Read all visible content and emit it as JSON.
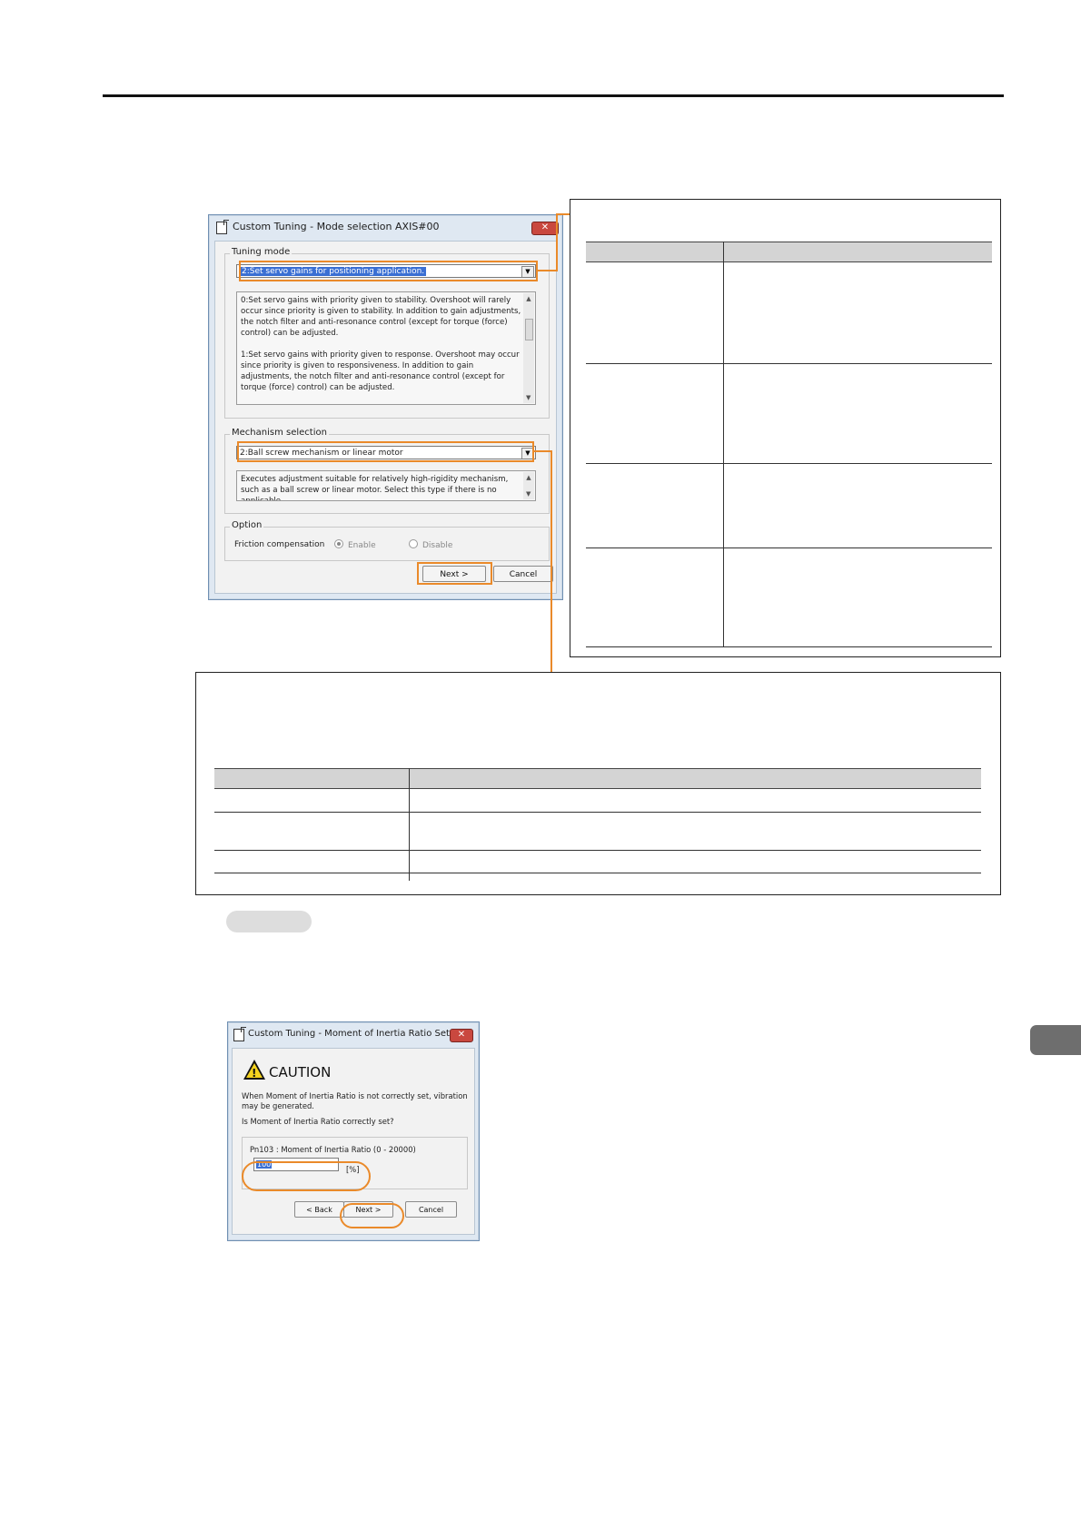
{
  "mode_dialog": {
    "title": "Custom Tuning - Mode selection AXIS#00",
    "close_label": "✕",
    "tuning_mode": {
      "group_label": "Tuning mode",
      "selected": "2:Set servo gains for positioning application.",
      "description": [
        "0:Set servo gains with priority given to stability. Overshoot will rarely occur since priority is given to stability. In addition to gain adjustments, the notch filter and anti-resonance control (except for torque (force) control) can be adjusted.",
        "1:Set servo gains with priority given to response. Overshoot may occur since priority is given to responsiveness. In addition to gain adjustments, the notch filter and anti-resonance control (except for torque (force) control) can be adjusted."
      ]
    },
    "mechanism": {
      "group_label": "Mechanism selection",
      "selected": "2:Ball screw mechanism or linear motor",
      "description": "Executes adjustment suitable for relatively high-rigidity mechanism, such as a ball screw or linear motor. Select this type if there is no applicable"
    },
    "option": {
      "group_label": "Option",
      "friction_label": "Friction compensation",
      "enable_label": "Enable",
      "disable_label": "Disable"
    },
    "next_label": "Next >",
    "cancel_label": "Cancel"
  },
  "inertia_dialog": {
    "title": "Custom Tuning - Moment of Inertia Ratio Setti...",
    "close_label": "✕",
    "caution_label": "CAUTION",
    "message1": "When Moment of Inertia Ratio is not correctly set, vibration may be generated.",
    "message2": "Is Moment of Inertia Ratio correctly set?",
    "param_label": "Pn103 : Moment of Inertia Ratio (0 - 20000)",
    "value": "100",
    "unit": "[%]",
    "back_label": "< Back",
    "next_label": "Next >",
    "cancel_label": "Cancel"
  }
}
